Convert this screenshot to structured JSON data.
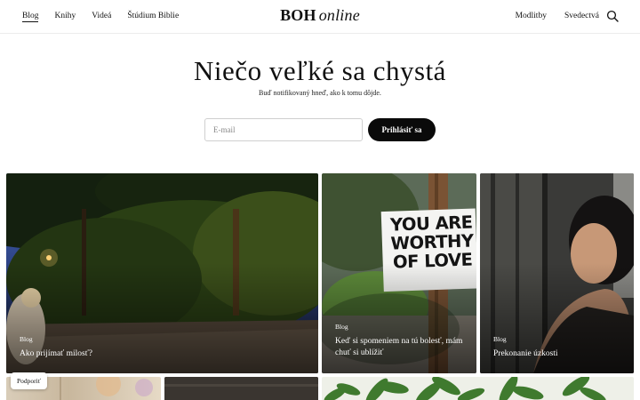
{
  "header": {
    "nav_left": [
      {
        "label": "Blog",
        "active": true
      },
      {
        "label": "Knihy"
      },
      {
        "label": "Videá"
      },
      {
        "label": "Štúdium Biblie"
      }
    ],
    "logo_main": "BOH",
    "logo_sub": "online",
    "nav_right": [
      {
        "label": "Modlitby"
      },
      {
        "label": "Svedectvá"
      }
    ],
    "search_icon": "search-icon"
  },
  "hero": {
    "title": "Niečo veľké sa chystá",
    "subtitle": "Buď notifikovaný hneď, ako k tomu dôjde.",
    "email_placeholder": "E-mail",
    "subscribe_label": "Prihlásiť sa"
  },
  "posts": [
    {
      "category": "Blog",
      "title": "Ako prijímať milosť?"
    },
    {
      "category": "Blog",
      "title": "Keď si spomeniem na tú bolesť, mám chuť si ublížiť",
      "sign_text": "YOU ARE WORTHY OF LOVE"
    },
    {
      "category": "Blog",
      "title": "Prekonanie úzkosti"
    }
  ],
  "support": {
    "label": "Podporiť"
  },
  "colors": {
    "accent": "#0a0a0a",
    "border": "#cfcfcf"
  }
}
